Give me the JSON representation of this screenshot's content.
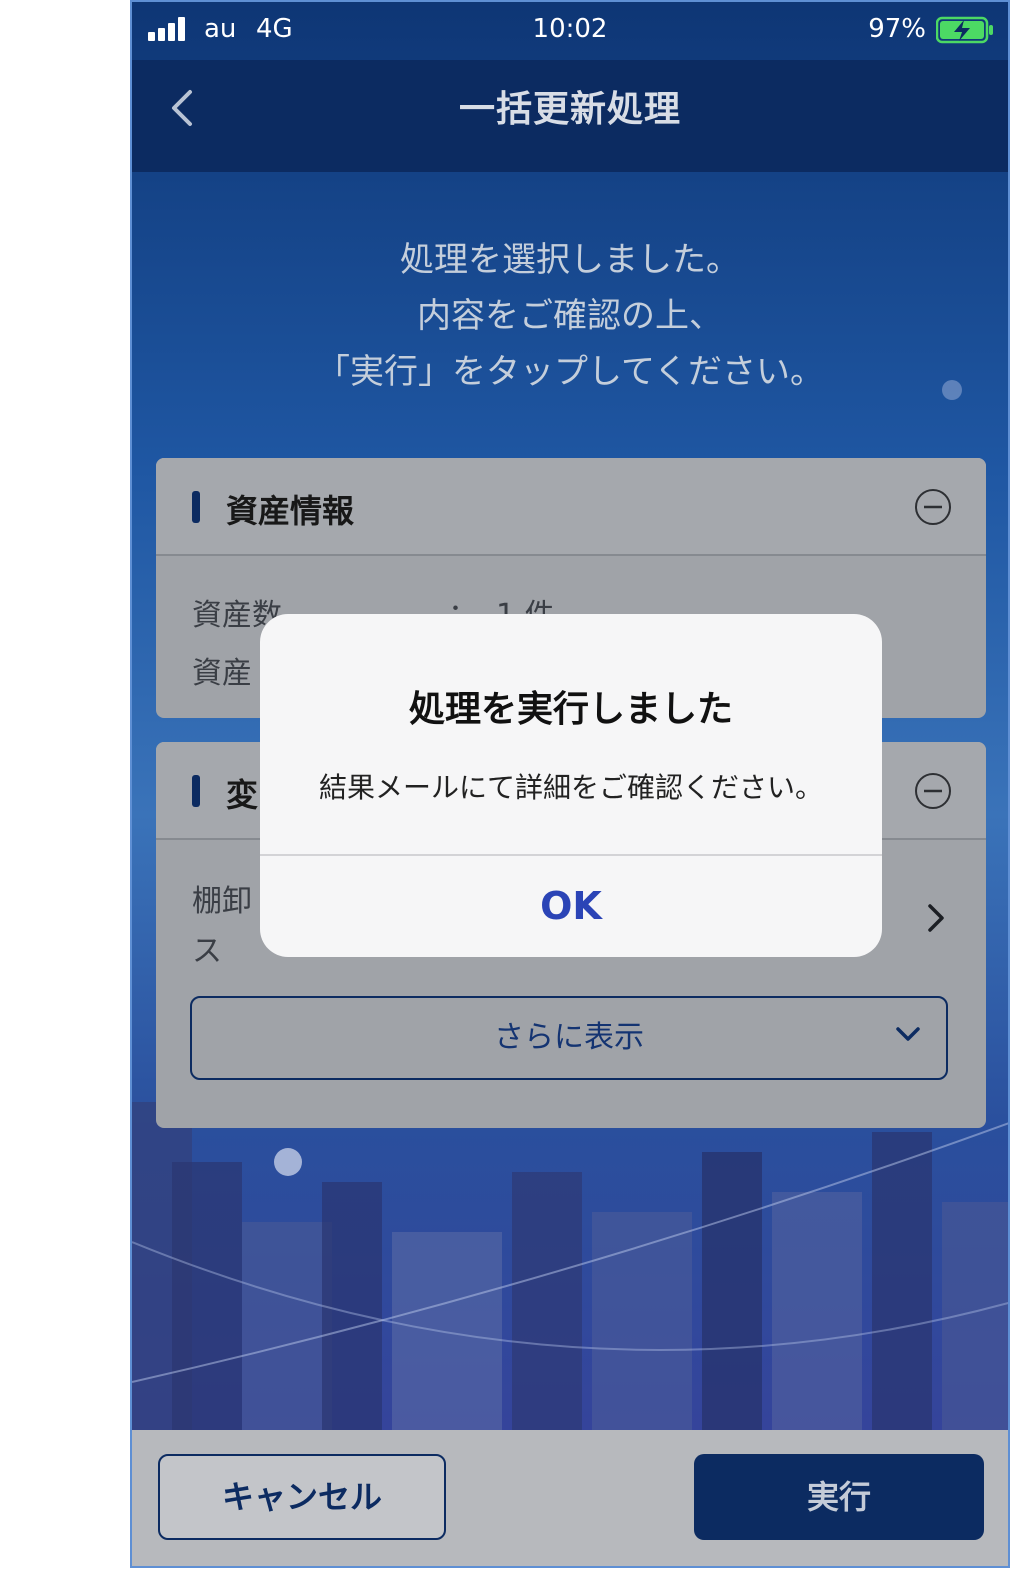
{
  "status": {
    "carrier": "au",
    "network": "4G",
    "time": "10:02",
    "battery": "97%"
  },
  "nav": {
    "title": "一括更新処理",
    "back_icon": "chevron-left-icon"
  },
  "intro": {
    "line1": "処理を選択しました。",
    "line2": "内容をご確認の上、",
    "line3": "「実行」をタップしてください。"
  },
  "asset_card": {
    "title": "資産情報",
    "row1_label": "資産数",
    "row1_sep": "：",
    "row1_value": "1 件",
    "row2_label": "資産"
  },
  "change_card": {
    "title": "変",
    "row_label_line1": "棚卸",
    "row_label_line2": "ス",
    "more_label": "さらに表示"
  },
  "dialog": {
    "title": "処理を実行しました",
    "message": "結果メールにて詳細をご確認ください。",
    "ok_label": "OK"
  },
  "footer": {
    "cancel_label": "キャンセル",
    "execute_label": "実行"
  },
  "colors": {
    "navy": "#0c2b61",
    "ok_blue": "#2b44b6"
  }
}
